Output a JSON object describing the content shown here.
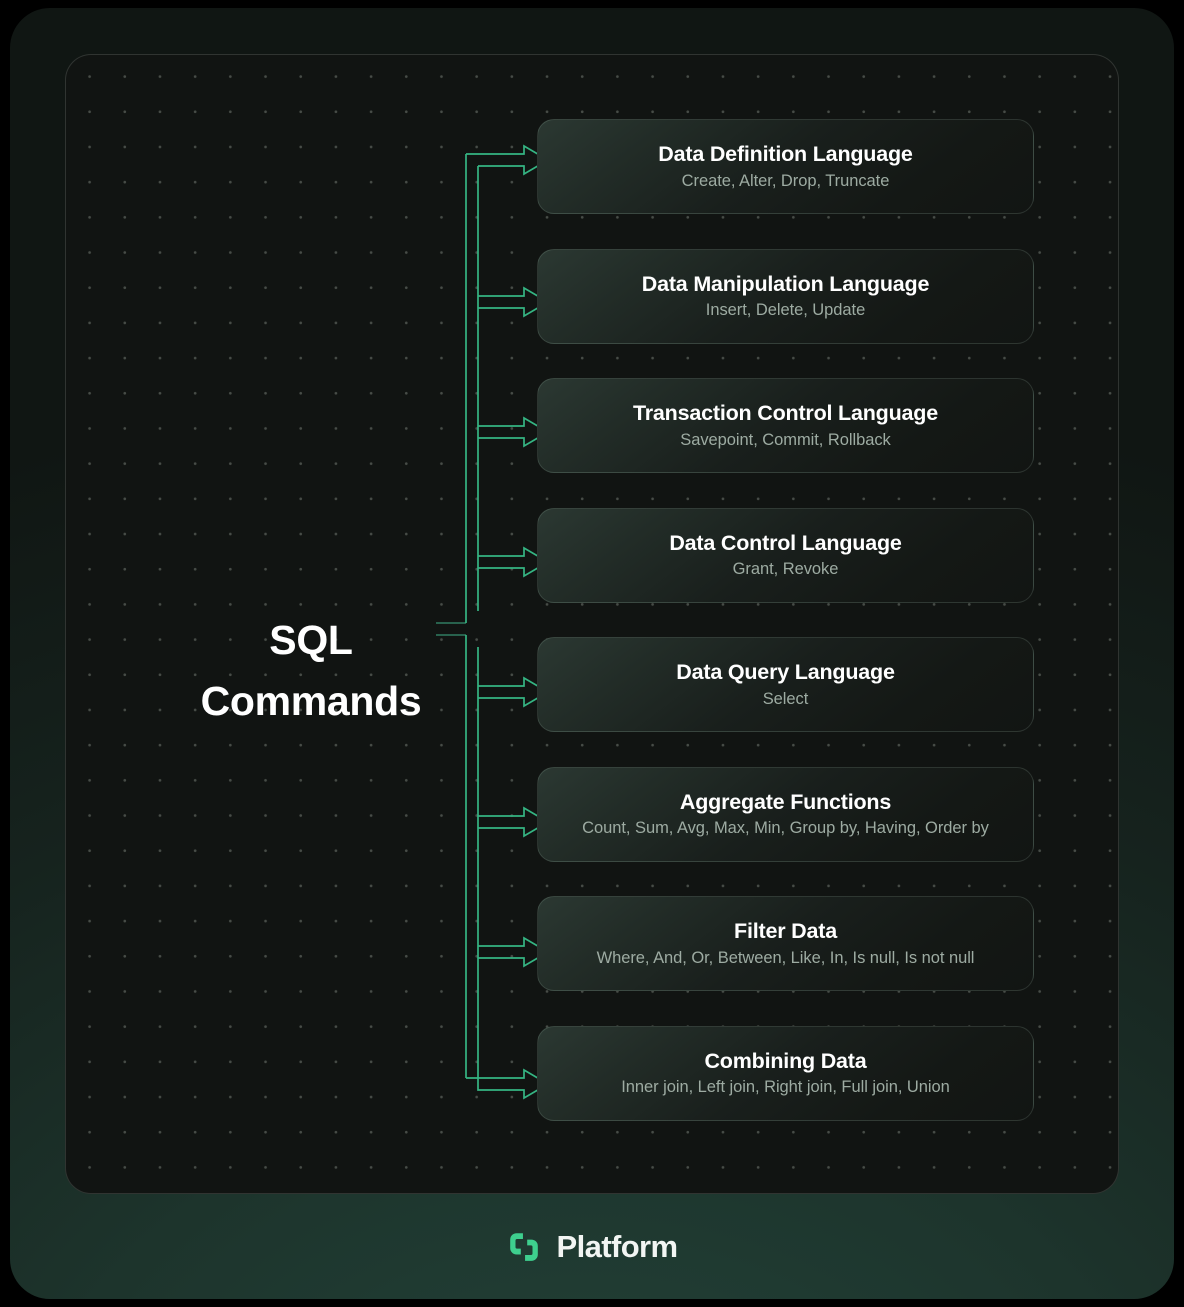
{
  "diagram": {
    "heading_line1": "SQL",
    "heading_line2": "Commands",
    "accent_color": "#3ecf8e",
    "panel_background": "#111412",
    "card_title_color": "#ffffff",
    "card_subtitle_color": "#9daba2",
    "cards": [
      {
        "title": "Data Definition Language",
        "subtitle": "Create, Alter, Drop, Truncate"
      },
      {
        "title": "Data Manipulation Language",
        "subtitle": "Insert, Delete, Update"
      },
      {
        "title": "Transaction Control Language",
        "subtitle": "Savepoint, Commit, Rollback"
      },
      {
        "title": "Data Control Language",
        "subtitle": "Grant, Revoke"
      },
      {
        "title": "Data Query Language",
        "subtitle": "Select"
      },
      {
        "title": "Aggregate Functions",
        "subtitle": "Count, Sum, Avg, Max, Min, Group by, Having, Order by"
      },
      {
        "title": "Filter Data",
        "subtitle": "Where, And, Or, Between, Like, In, Is null, Is not null"
      },
      {
        "title": "Combining Data",
        "subtitle": "Inner join, Left join, Right join, Full join, Union"
      }
    ]
  },
  "footer": {
    "brand": "Platform",
    "logo_icon": "brackets-logo-icon",
    "logo_color": "#3ecf8e"
  }
}
